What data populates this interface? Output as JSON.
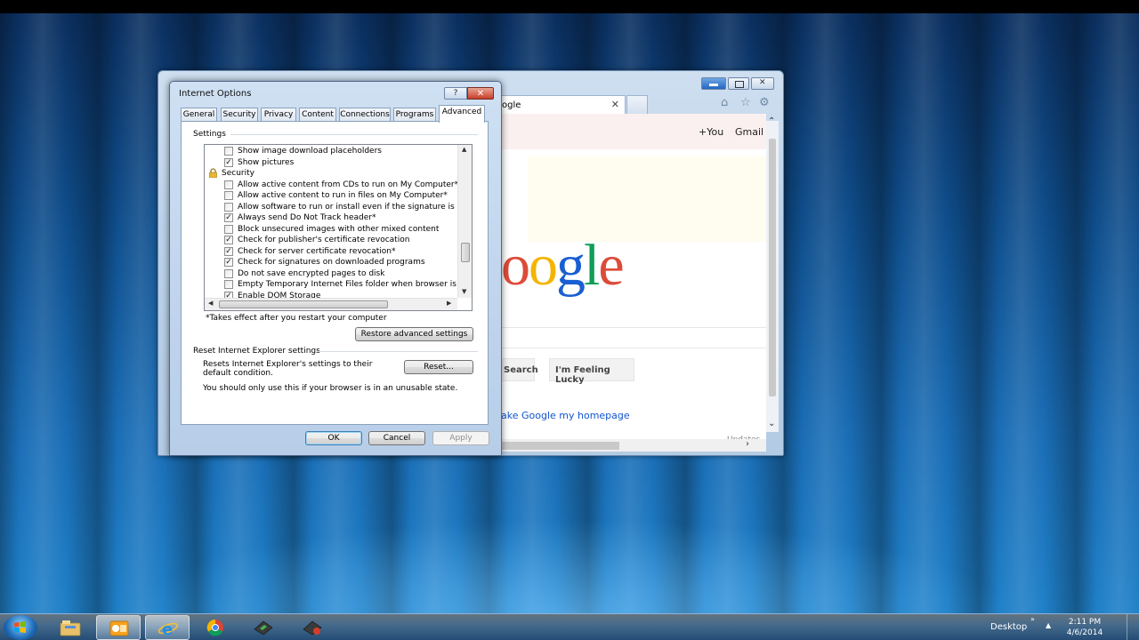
{
  "browser": {
    "tab_title": "ogle",
    "header_links": [
      "+You",
      "Gmail"
    ],
    "logo_letters": [
      "o",
      "o",
      "g",
      "l",
      "e"
    ],
    "logo_colors": [
      "#dd4b39",
      "#f4b400",
      "#1a5fd1",
      "#0f9d58",
      "#dd4b39"
    ],
    "search_button": "Search",
    "lucky_button": "I'm Feeling Lucky",
    "homepage_link": "ake Google my homepage",
    "updates_text": "Updates"
  },
  "dialog": {
    "title": "Internet Options",
    "help_label": "?",
    "close_label": "✕",
    "tabs": [
      "General",
      "Security",
      "Privacy",
      "Content",
      "Connections",
      "Programs",
      "Advanced"
    ],
    "active_tab": "Advanced",
    "settings_label": "Settings",
    "list": [
      {
        "label": "Show image download placeholders",
        "checked": false,
        "type": "checkbox"
      },
      {
        "label": "Show pictures",
        "checked": true,
        "type": "checkbox"
      },
      {
        "label": "Security",
        "type": "group"
      },
      {
        "label": "Allow active content from CDs to run on My Computer*",
        "checked": false,
        "type": "checkbox"
      },
      {
        "label": "Allow active content to run in files on My Computer*",
        "checked": false,
        "type": "checkbox"
      },
      {
        "label": "Allow software to run or install even if the signature is inva",
        "checked": false,
        "type": "checkbox"
      },
      {
        "label": "Always send Do Not Track header*",
        "checked": true,
        "type": "checkbox"
      },
      {
        "label": "Block unsecured images with other mixed content",
        "checked": false,
        "type": "checkbox"
      },
      {
        "label": "Check for publisher's certificate revocation",
        "checked": true,
        "type": "checkbox"
      },
      {
        "label": "Check for server certificate revocation*",
        "checked": true,
        "type": "checkbox"
      },
      {
        "label": "Check for signatures on downloaded programs",
        "checked": true,
        "type": "checkbox"
      },
      {
        "label": "Do not save encrypted pages to disk",
        "checked": false,
        "type": "checkbox"
      },
      {
        "label": "Empty Temporary Internet Files folder when browser is clo",
        "checked": false,
        "type": "checkbox"
      },
      {
        "label": "Enable DOM Storage",
        "checked": true,
        "type": "checkbox"
      }
    ],
    "restart_note": "*Takes effect after you restart your computer",
    "restore_button": "Restore advanced settings",
    "reset_section_label": "Reset Internet Explorer settings",
    "reset_description": "Resets Internet Explorer's settings to their default condition.",
    "reset_button": "Reset...",
    "reset_warning": "You should only use this if your browser is in an unusable state.",
    "ok_button": "OK",
    "cancel_button": "Cancel",
    "apply_button": "Apply",
    "apply_enabled": false
  },
  "taskbar": {
    "desktop_label": "Desktop",
    "tray_expand": "»",
    "tray_arrow": "▲",
    "clock_time": "2:11 PM",
    "clock_date": "4/6/2014",
    "pinned": [
      "windows-explorer-icon",
      "outlook-icon",
      "internet-explorer-icon",
      "chrome-icon",
      "app-icon",
      "app-icon-2"
    ]
  }
}
